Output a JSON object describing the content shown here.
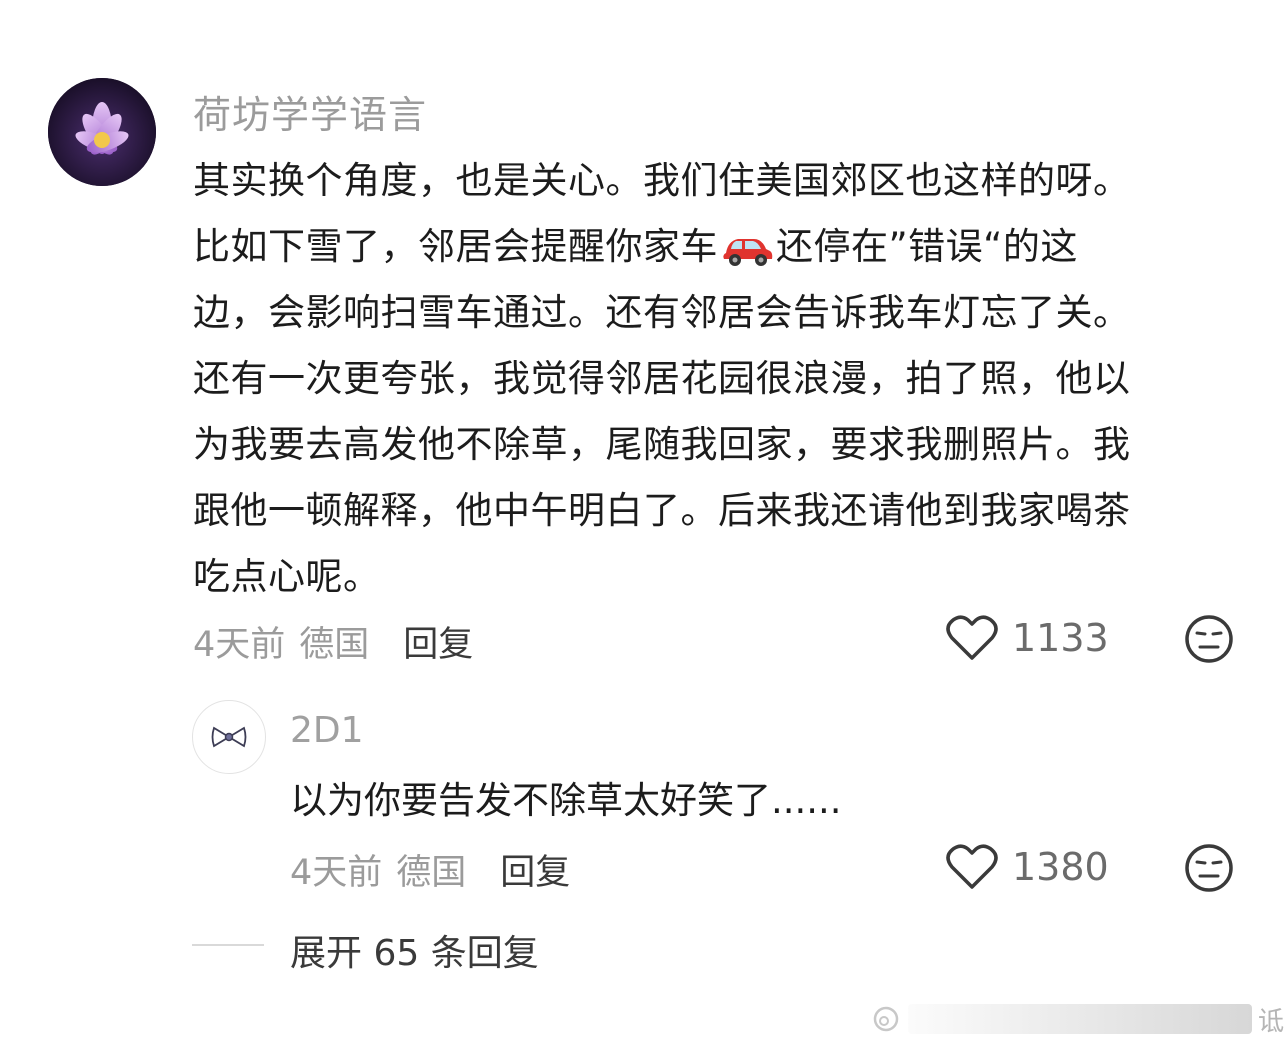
{
  "comment": {
    "username": "荷坊学学语言",
    "content_before_emoji": "其实换个角度，也是关心。我们住美国郊区也这样的呀。\n比如下雪了，邻居会提醒你家车",
    "content_after_emoji": "还停在”错误“的这\n边，会影响扫雪车通过。还有邻居会告诉我车灯忘了关。\n还有一次更夸张，我觉得邻居花园很浪漫，拍了照，他以\n为我要去高发他不除草，尾随我回家，要求我删照片。我\n跟他一顿解释，他中午明白了。后来我还请他到我家喝茶\n吃点心呢。",
    "time": "4天前",
    "location": "德国",
    "reply_label": "回复",
    "like_count": "1133"
  },
  "reply": {
    "username": "2D1",
    "content": "以为你要告发不除草太好笑了......",
    "time": "4天前",
    "location": "德国",
    "reply_label": "回复",
    "like_count": "1380"
  },
  "expand": {
    "label": "展开 65 条回复"
  },
  "watermark": {
    "text": "诋"
  },
  "icons": {
    "like": "heart-outline-icon",
    "dislike": "meh-face-icon",
    "car": "red-car-emoji-icon"
  },
  "colors": {
    "meta_gray": "#9b9b9b",
    "text_dark": "#1c1c1c",
    "car_red": "#e0342f"
  }
}
